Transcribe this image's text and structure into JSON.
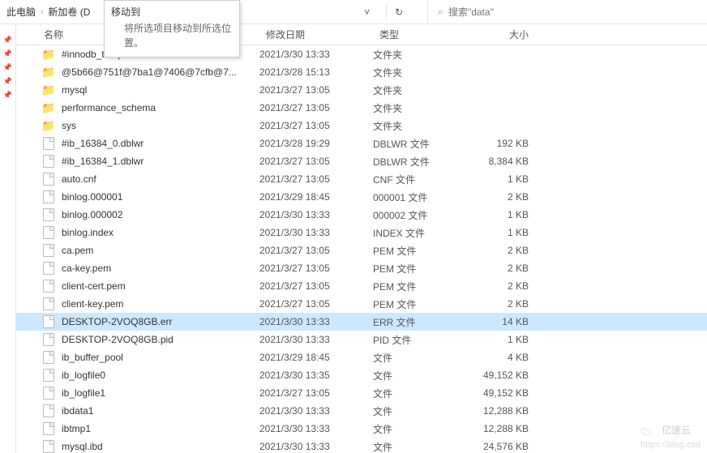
{
  "breadcrumb": {
    "item1": "此电脑",
    "item2": "新加卷 (D"
  },
  "tooltip": {
    "title": "移动到",
    "desc": "将所选项目移动到所选位置。"
  },
  "toolbar": {
    "dropdown_glyph": "˅",
    "refresh_glyph": "↻"
  },
  "search": {
    "icon": "⌕",
    "placeholder": "搜索\"data\""
  },
  "columns": {
    "name": "名称",
    "date": "修改日期",
    "type": "类型",
    "size": "大小"
  },
  "rows": [
    {
      "kind": "folder",
      "name": "#innodb_temp",
      "date": "2021/3/30 13:33",
      "type": "文件夹",
      "size": ""
    },
    {
      "kind": "folder",
      "name": "@5b66@751f@7ba1@7406@7cfb@7...",
      "date": "2021/3/28 15:13",
      "type": "文件夹",
      "size": ""
    },
    {
      "kind": "folder",
      "name": "mysql",
      "date": "2021/3/27 13:05",
      "type": "文件夹",
      "size": ""
    },
    {
      "kind": "folder",
      "name": "performance_schema",
      "date": "2021/3/27 13:05",
      "type": "文件夹",
      "size": ""
    },
    {
      "kind": "folder",
      "name": "sys",
      "date": "2021/3/27 13:05",
      "type": "文件夹",
      "size": ""
    },
    {
      "kind": "file",
      "name": "#ib_16384_0.dblwr",
      "date": "2021/3/28 19:29",
      "type": "DBLWR 文件",
      "size": "192 KB"
    },
    {
      "kind": "file",
      "name": "#ib_16384_1.dblwr",
      "date": "2021/3/27 13:05",
      "type": "DBLWR 文件",
      "size": "8,384 KB"
    },
    {
      "kind": "file",
      "name": "auto.cnf",
      "date": "2021/3/27 13:05",
      "type": "CNF 文件",
      "size": "1 KB"
    },
    {
      "kind": "file",
      "name": "binlog.000001",
      "date": "2021/3/29 18:45",
      "type": "000001 文件",
      "size": "2 KB"
    },
    {
      "kind": "file",
      "name": "binlog.000002",
      "date": "2021/3/30 13:33",
      "type": "000002 文件",
      "size": "1 KB"
    },
    {
      "kind": "file",
      "name": "binlog.index",
      "date": "2021/3/30 13:33",
      "type": "INDEX 文件",
      "size": "1 KB"
    },
    {
      "kind": "file",
      "name": "ca.pem",
      "date": "2021/3/27 13:05",
      "type": "PEM 文件",
      "size": "2 KB"
    },
    {
      "kind": "file",
      "name": "ca-key.pem",
      "date": "2021/3/27 13:05",
      "type": "PEM 文件",
      "size": "2 KB"
    },
    {
      "kind": "file",
      "name": "client-cert.pem",
      "date": "2021/3/27 13:05",
      "type": "PEM 文件",
      "size": "2 KB"
    },
    {
      "kind": "file",
      "name": "client-key.pem",
      "date": "2021/3/27 13:05",
      "type": "PEM 文件",
      "size": "2 KB"
    },
    {
      "kind": "file",
      "name": "DESKTOP-2VOQ8GB.err",
      "date": "2021/3/30 13:33",
      "type": "ERR 文件",
      "size": "14 KB",
      "selected": true
    },
    {
      "kind": "file",
      "name": "DESKTOP-2VOQ8GB.pid",
      "date": "2021/3/30 13:33",
      "type": "PID 文件",
      "size": "1 KB"
    },
    {
      "kind": "file",
      "name": "ib_buffer_pool",
      "date": "2021/3/29 18:45",
      "type": "文件",
      "size": "4 KB"
    },
    {
      "kind": "file",
      "name": "ib_logfile0",
      "date": "2021/3/30 13:35",
      "type": "文件",
      "size": "49,152 KB"
    },
    {
      "kind": "file",
      "name": "ib_logfile1",
      "date": "2021/3/27 13:05",
      "type": "文件",
      "size": "49,152 KB"
    },
    {
      "kind": "file",
      "name": "ibdata1",
      "date": "2021/3/30 13:33",
      "type": "文件",
      "size": "12,288 KB"
    },
    {
      "kind": "file",
      "name": "ibtmp1",
      "date": "2021/3/30 13:33",
      "type": "文件",
      "size": "12,288 KB"
    },
    {
      "kind": "file",
      "name": "mysql.ibd",
      "date": "2021/3/30 13:33",
      "type": "文件",
      "size": "24,576 KB"
    }
  ],
  "watermark": {
    "text1": "亿速云",
    "text2": "https://blog.csd"
  }
}
